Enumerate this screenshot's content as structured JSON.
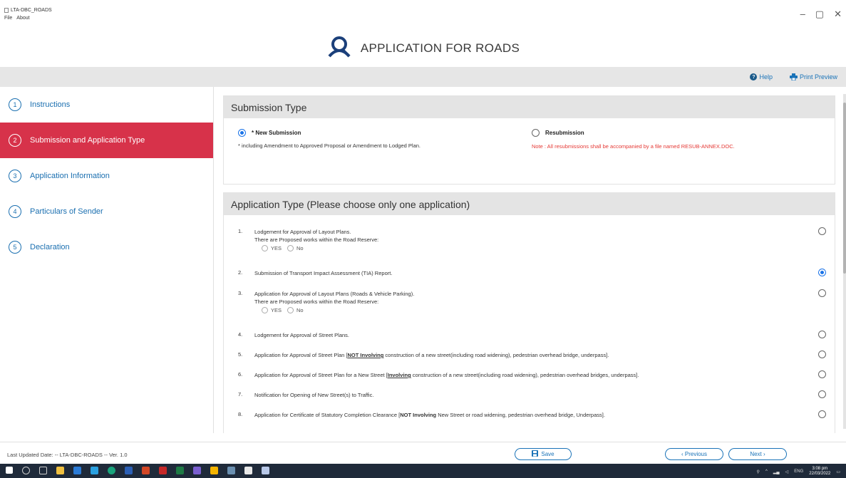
{
  "window": {
    "title": "LTA-DBC_ROADS",
    "menu": [
      "File",
      "About"
    ],
    "controls": [
      "–",
      "▢",
      "✕"
    ]
  },
  "header": {
    "title": "APPLICATION FOR ROADS"
  },
  "toplinks": {
    "help": "Help",
    "print": "Print Preview"
  },
  "sidebar": {
    "steps": [
      {
        "num": "1",
        "label": "Instructions"
      },
      {
        "num": "2",
        "label": "Submission and Application Type"
      },
      {
        "num": "3",
        "label": "Application Information"
      },
      {
        "num": "4",
        "label": "Particulars of Sender"
      },
      {
        "num": "5",
        "label": "Declaration"
      }
    ],
    "active_index": 1
  },
  "submission": {
    "heading": "Submission Type",
    "new_label": "* New Submission",
    "new_note": "* including Amendment to Approved Proposal or Amendment to Lodged Plan.",
    "resub_label": "Resubmission",
    "resub_note": "Note : All resubmissions shall be accompanied by a file named RESUB-ANNEX.DOC.",
    "selected": "new"
  },
  "application": {
    "heading": "Application Type (Please choose only one application)",
    "road_reserve_question": "There are Proposed works within the Road Reserve:",
    "yes": "YES",
    "no": "No",
    "items": [
      {
        "n": "1.",
        "text": "Lodgement for Approval of Layout Plans."
      },
      {
        "n": "2.",
        "text": "Submission of Transport Impact Assessment (TIA) Report."
      },
      {
        "n": "3.",
        "text": "Application for Approval of Layout Plans (Roads & Vehicle Parking)."
      },
      {
        "n": "4.",
        "text": "Lodgement for Approval of Street Plans."
      },
      {
        "n": "5.",
        "pre": "Application for Approval of Street Plan [",
        "bold": "NOT Involving",
        "post": " construction of a new street(including road widening), pedestrian overhead bridge, underpass]."
      },
      {
        "n": "6.",
        "pre": "Application for Approval of Street Plan for a New Street [",
        "bold": "Involving",
        "post": " construction of a new street(including road widening), pedestrian overhead bridges, underpass]."
      },
      {
        "n": "7.",
        "text": "Notification for Opening of New Street(s) to Traffic."
      },
      {
        "n": "8.",
        "pre": "Application for Certificate of Statutory Completion Clearance [",
        "bold": "NOT Involving",
        "post": " New Street or road widening, pedestrian overhead bridge, Underpass]."
      }
    ],
    "selected_index": 1
  },
  "footer": {
    "last_updated": "Last Updated Date: -- LTA-DBC-ROADS -- Ver. 1.0",
    "save": "Save",
    "previous": "‹ Previous",
    "next": "Next ›"
  },
  "taskbar": {
    "time": "3:08 pm",
    "date": "22/03/2022",
    "lang": "ENG"
  },
  "colors": {
    "active_step": "#d7324a",
    "link": "#1a73b8",
    "warning": "#e53935",
    "taskbar": "#1f2a3a"
  }
}
